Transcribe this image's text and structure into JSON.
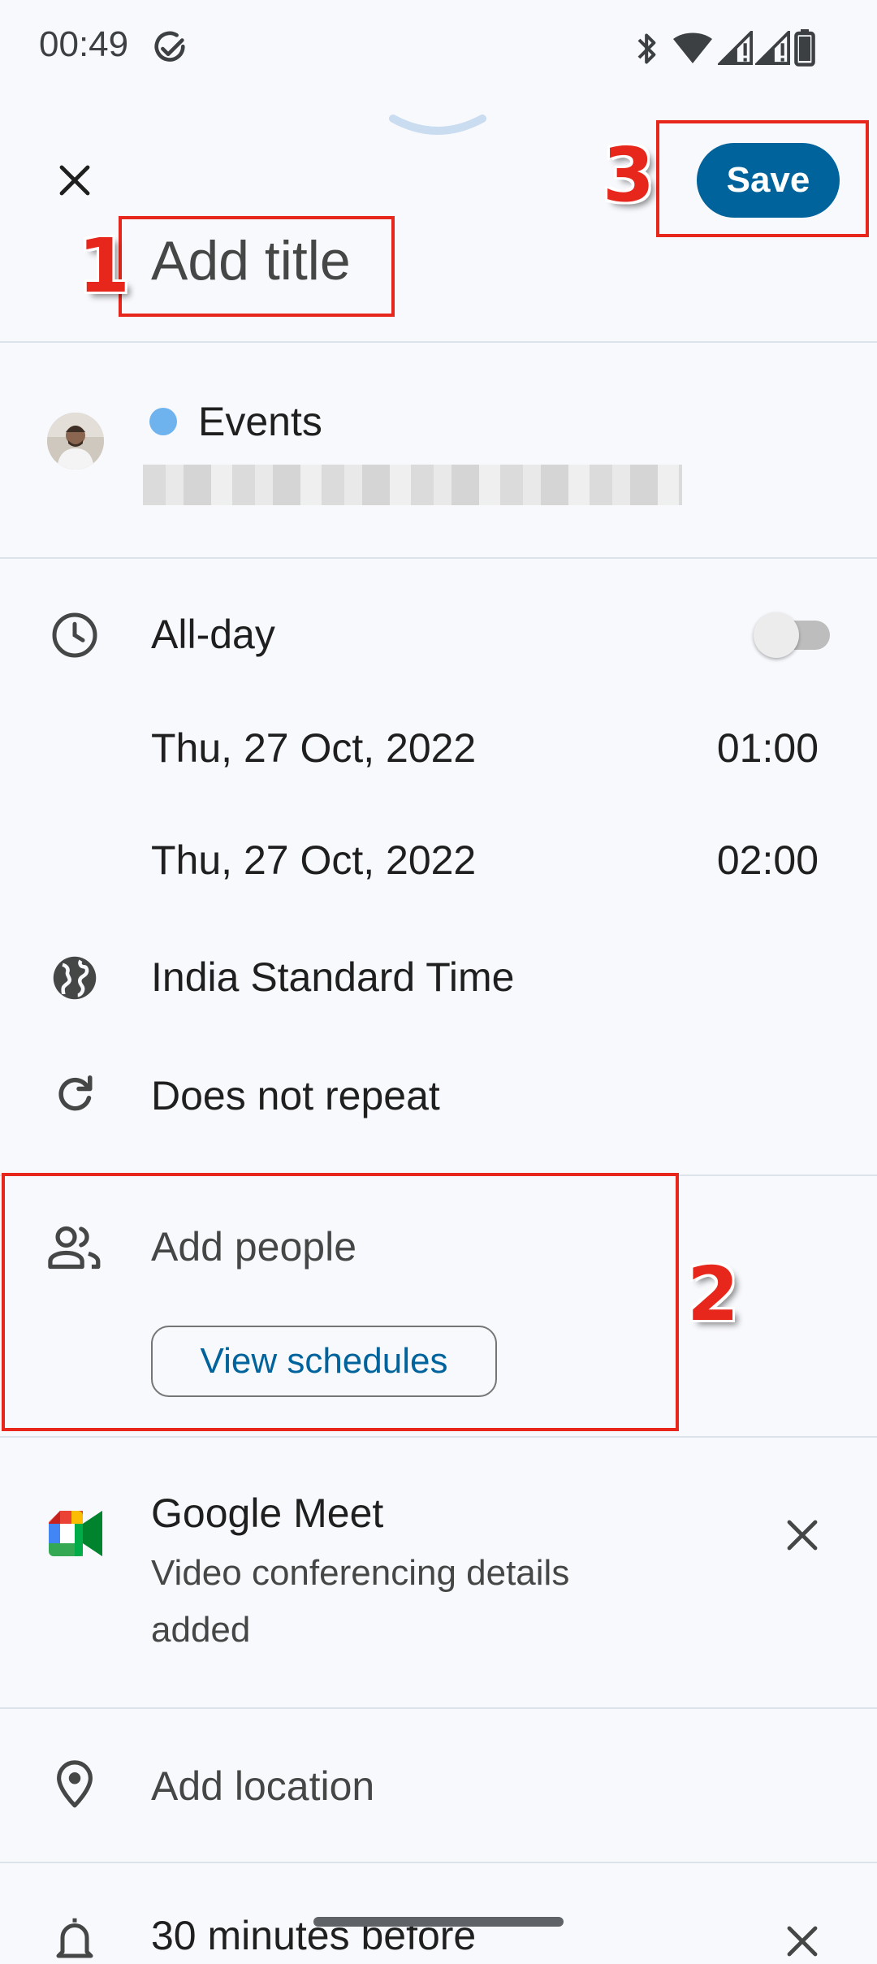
{
  "status_bar": {
    "time": "00:49"
  },
  "header": {
    "title_placeholder": "Add title",
    "save_label": "Save"
  },
  "account": {
    "calendar_name": "Events",
    "calendar_color": "#6fb3ee"
  },
  "time": {
    "all_day_label": "All-day",
    "all_day_enabled": false,
    "start_date": "Thu, 27 Oct, 2022",
    "start_time": "01:00",
    "end_date": "Thu, 27 Oct, 2022",
    "end_time": "02:00",
    "timezone": "India Standard Time",
    "repeat": "Does not repeat"
  },
  "people": {
    "placeholder": "Add people",
    "view_schedules_label": "View schedules"
  },
  "meet": {
    "title": "Google Meet",
    "subtitle_line1": "Video conferencing details",
    "subtitle_line2": "added"
  },
  "location": {
    "placeholder": "Add location"
  },
  "notification": {
    "label": "30 minutes before"
  },
  "annotations": {
    "n1": "1",
    "n2": "2",
    "n3": "3",
    "color": "#e8271c"
  },
  "colors": {
    "accent": "#00639b",
    "text_primary": "#1f1f1f",
    "text_secondary": "#444746",
    "divider": "#dde3ea"
  }
}
